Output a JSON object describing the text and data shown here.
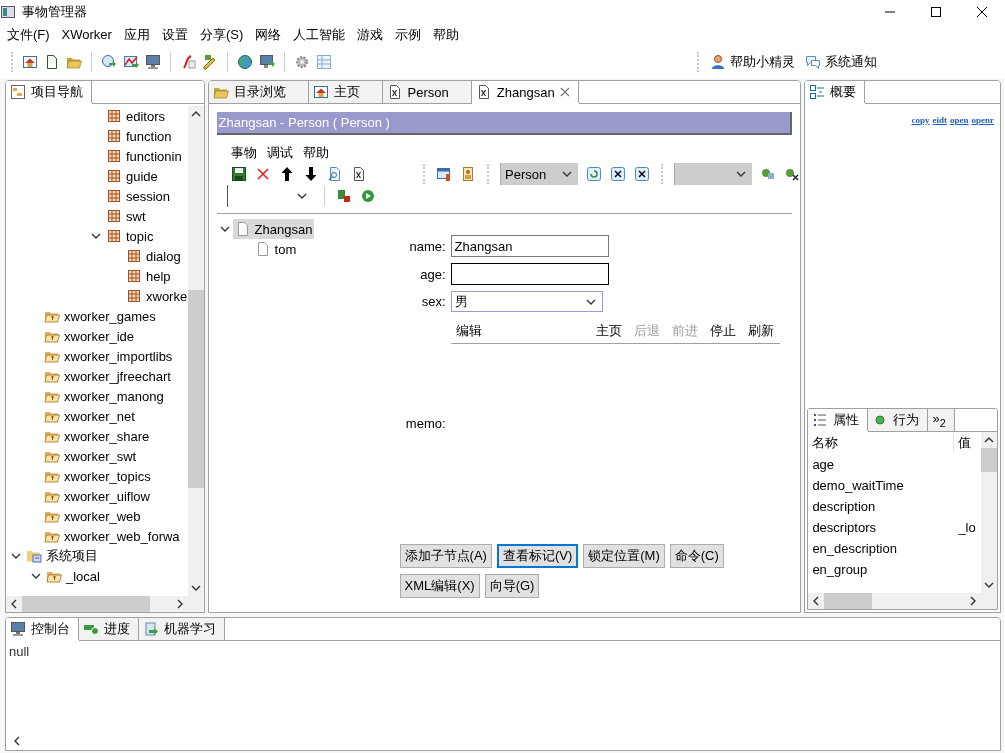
{
  "window": {
    "title": "事物管理器"
  },
  "menu": [
    "文件(F)",
    "XWorker",
    "应用",
    "设置",
    "分享(S)",
    "网络",
    "人工智能",
    "游戏",
    "示例",
    "帮助"
  ],
  "toolbar_right": [
    {
      "label": "帮助小精灵",
      "kind": "helper"
    },
    {
      "label": "系统通知",
      "kind": "notice"
    }
  ],
  "navigator": {
    "tab": "项目导航",
    "tree": [
      {
        "label": "editors",
        "kind": "node"
      },
      {
        "label": "function",
        "kind": "node"
      },
      {
        "label": "functionin",
        "kind": "node"
      },
      {
        "label": "guide",
        "kind": "node"
      },
      {
        "label": "session",
        "kind": "node"
      },
      {
        "label": "swt",
        "kind": "node"
      },
      {
        "label": "topic",
        "kind": "node",
        "expanded": true,
        "children": [
          {
            "label": "dialog",
            "kind": "node"
          },
          {
            "label": "help",
            "kind": "node"
          },
          {
            "label": "xworke",
            "kind": "node"
          }
        ]
      },
      {
        "label": "xworker_games",
        "kind": "project"
      },
      {
        "label": "xworker_ide",
        "kind": "project"
      },
      {
        "label": "xworker_importlibs",
        "kind": "project"
      },
      {
        "label": "xworker_jfreechart",
        "kind": "project"
      },
      {
        "label": "xworker_manong",
        "kind": "project"
      },
      {
        "label": "xworker_net",
        "kind": "project"
      },
      {
        "label": "xworker_share",
        "kind": "project"
      },
      {
        "label": "xworker_swt",
        "kind": "project"
      },
      {
        "label": "xworker_topics",
        "kind": "project"
      },
      {
        "label": "xworker_uiflow",
        "kind": "project"
      },
      {
        "label": "xworker_web",
        "kind": "project"
      },
      {
        "label": "xworker_web_forwa",
        "kind": "project"
      },
      {
        "label": "系统项目",
        "kind": "group",
        "expanded": true,
        "children": [
          {
            "label": "_local",
            "kind": "project",
            "expanded": true
          }
        ]
      }
    ]
  },
  "editor": {
    "tabs": [
      {
        "label": "目录浏览",
        "kind": "folder",
        "selected": false
      },
      {
        "label": "主页",
        "kind": "home",
        "selected": false
      },
      {
        "label": "Person",
        "kind": "thing",
        "selected": false
      },
      {
        "label": "Zhangsan",
        "kind": "thing",
        "selected": true
      }
    ],
    "header": "Zhangsan - Person ( Person )",
    "menu": [
      "事物",
      "调试",
      "帮助"
    ],
    "class_select": "Person",
    "tree": [
      {
        "label": "Zhangsan",
        "selected": true,
        "expanded": true,
        "children": [
          {
            "label": "tom",
            "selected": false
          }
        ]
      }
    ],
    "fields": [
      {
        "label": "name:",
        "kind": "text",
        "value": "Zhangsan",
        "focused": false
      },
      {
        "label": "age:",
        "kind": "text",
        "focused": true
      },
      {
        "label": "sex:",
        "kind": "select",
        "value": "男"
      }
    ],
    "memo": {
      "label": "memo:",
      "browser_title": "编辑",
      "actions": [
        {
          "label": "主页",
          "disabled": false
        },
        {
          "label": "后退",
          "disabled": true
        },
        {
          "label": "前进",
          "disabled": true
        },
        {
          "label": "停止",
          "disabled": false
        },
        {
          "label": "刷新",
          "disabled": false
        }
      ]
    },
    "buttons": [
      {
        "label": "添加子节点(A)",
        "focused": false
      },
      {
        "label": "查看标记(V)",
        "focused": true
      },
      {
        "label": "锁定位置(M)",
        "focused": false
      },
      {
        "label": "命令(C)",
        "focused": false
      },
      {
        "label": "XML编辑(X)",
        "focused": false
      },
      {
        "label": "向导(G)",
        "focused": false
      }
    ]
  },
  "outline": {
    "tab": "概要",
    "links": [
      "copy",
      "eidt",
      "open",
      "openr"
    ]
  },
  "properties": {
    "tabs": [
      {
        "label": "属性",
        "kind": "list",
        "selected": true
      },
      {
        "label": "行为",
        "kind": "dot",
        "selected": false
      },
      {
        "label": "»$_{2}$",
        "kind": "more",
        "selected": false
      }
    ],
    "columns": [
      "名称",
      "值"
    ],
    "rows": [
      {
        "name": "age"
      },
      {
        "name": "demo_waitTime"
      },
      {
        "name": "description"
      },
      {
        "name": "descriptors",
        "value": "_lo"
      },
      {
        "name": "en_description"
      },
      {
        "name": "en_group"
      }
    ]
  },
  "console": {
    "tabs": [
      {
        "label": "控制台",
        "kind": "monitor",
        "selected": true
      },
      {
        "label": "进度",
        "kind": "progress",
        "selected": false
      },
      {
        "label": "机器学习",
        "kind": "learn",
        "selected": false
      }
    ],
    "text": "null"
  }
}
